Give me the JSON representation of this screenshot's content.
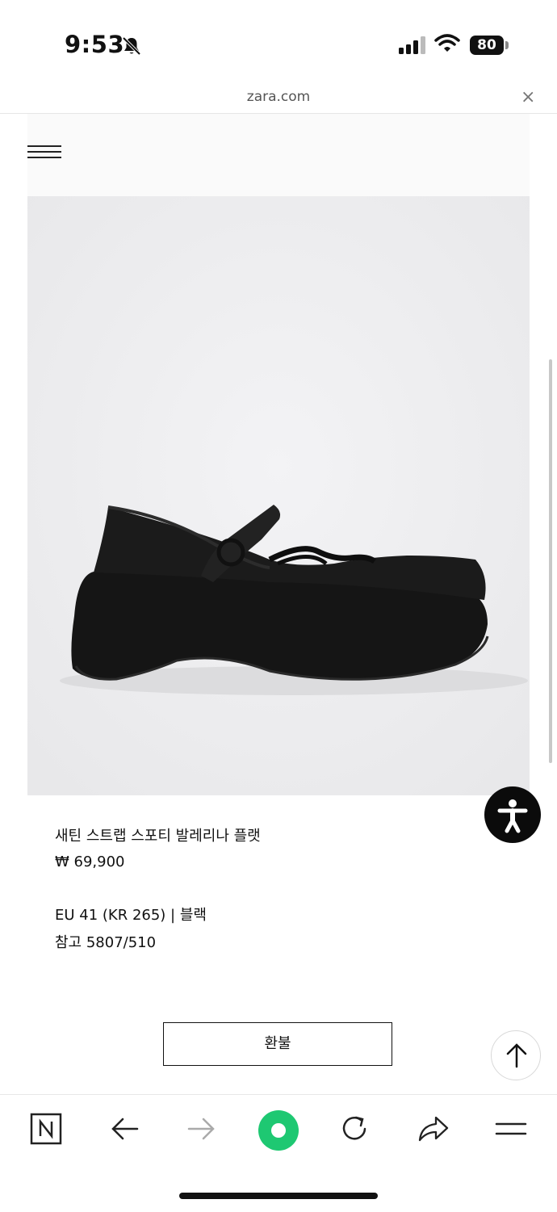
{
  "status_bar": {
    "time": "9:53",
    "battery": "80"
  },
  "browser": {
    "url": "zara.com",
    "close_label": "×"
  },
  "product": {
    "name": "새틴 스트랩 스포티 발레리나 플랫",
    "price": "₩ 69,900",
    "size_color": "EU 41 (KR 265) | 블랙",
    "reference": "참고 5807/510"
  },
  "actions": {
    "refund_label": "환불"
  },
  "toolbar": {
    "items": [
      "naver-home-icon",
      "back-arrow-icon",
      "forward-arrow-icon",
      "green-dot-icon",
      "refresh-icon",
      "share-icon",
      "menu-icon"
    ]
  },
  "colors": {
    "accent_green": "#1ec872",
    "text": "#111111",
    "image_bg": "#efeff1"
  }
}
